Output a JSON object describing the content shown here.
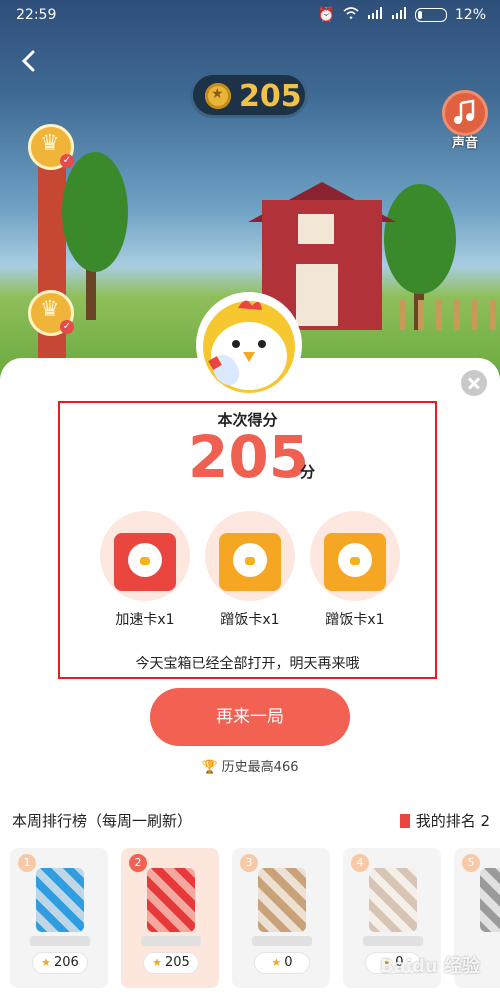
{
  "status_bar": {
    "time": "22:59",
    "battery": "12%"
  },
  "game": {
    "coins": "205",
    "sound_label": "声音"
  },
  "result": {
    "title": "本次得分",
    "score": "205",
    "unit": "分",
    "rewards": [
      {
        "label": "加速卡x1",
        "icon": "speed-card-icon",
        "color": "#e8463e"
      },
      {
        "label": "蹭饭卡x1",
        "icon": "meal-card-icon",
        "color": "#f5a623"
      },
      {
        "label": "蹭饭卡x1",
        "icon": "meal-card-icon",
        "color": "#f5a623"
      }
    ],
    "notice": "今天宝箱已经全部打开，明天再来哦"
  },
  "play_again_label": "再来一局",
  "best_score": "历史最高466",
  "leaderboard": {
    "title": "本周排行榜（每周一刷新）",
    "my_rank_label": "我的排名 2",
    "entries": [
      {
        "rank": "1",
        "score": "206"
      },
      {
        "rank": "2",
        "score": "205"
      },
      {
        "rank": "3",
        "score": "0"
      },
      {
        "rank": "4",
        "score": "0"
      },
      {
        "rank": "5",
        "score": ""
      }
    ]
  },
  "watermark": "Baidu 经验",
  "colors": {
    "accent": "#f26152",
    "highlight_border": "#e02020"
  }
}
